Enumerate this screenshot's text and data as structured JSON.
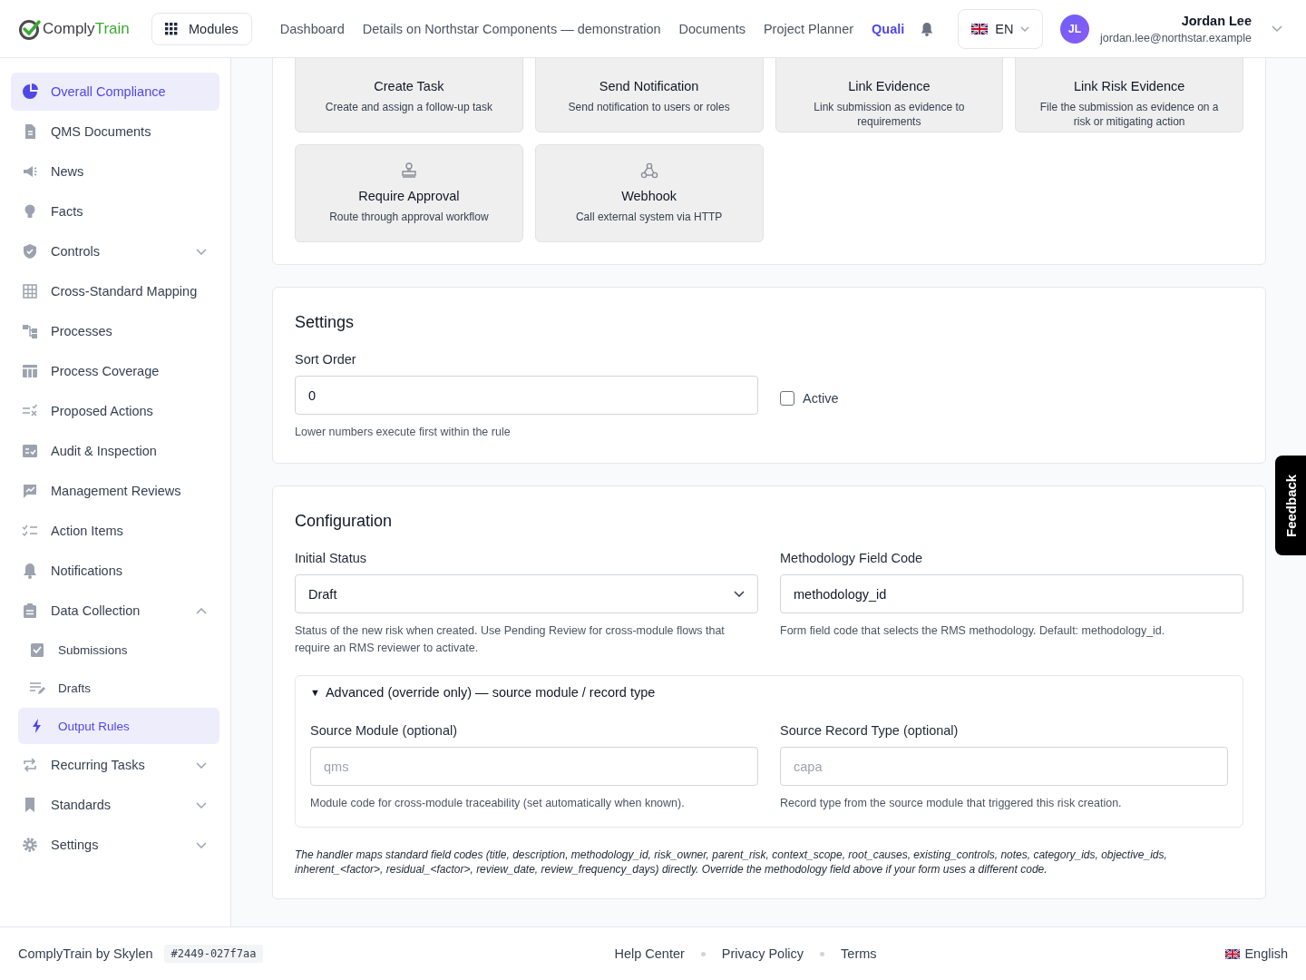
{
  "header": {
    "logo": {
      "first": "Comply",
      "second": "Train"
    },
    "modules_button": "Modules",
    "nav": [
      {
        "label": "Dashboard",
        "selected": false
      },
      {
        "label": "Details on Northstar Components — demonstration",
        "selected": false
      },
      {
        "label": "Documents",
        "selected": false
      },
      {
        "label": "Project Planner",
        "selected": false
      },
      {
        "label": "Quali",
        "selected": true
      }
    ],
    "language": "EN",
    "user": {
      "initials": "JL",
      "name": "Jordan Lee",
      "email": "jordan.lee@northstar.example"
    }
  },
  "sidebar": {
    "items": [
      {
        "label": "Overall Compliance",
        "selected": true
      },
      {
        "label": "QMS Documents",
        "selected": false
      },
      {
        "label": "News",
        "selected": false
      },
      {
        "label": "Facts",
        "selected": false
      },
      {
        "label": "Controls",
        "selected": false,
        "expanded": false
      },
      {
        "label": "Cross-Standard Mapping",
        "selected": false
      },
      {
        "label": "Processes",
        "selected": false
      },
      {
        "label": "Process Coverage",
        "selected": false
      },
      {
        "label": "Proposed Actions",
        "selected": false
      },
      {
        "label": "Audit & Inspection",
        "selected": false
      },
      {
        "label": "Management Reviews",
        "selected": false
      },
      {
        "label": "Action Items",
        "selected": false
      },
      {
        "label": "Notifications",
        "selected": false
      },
      {
        "label": "Data Collection",
        "selected": false,
        "expanded": true,
        "children": [
          {
            "label": "Submissions",
            "selected": false
          },
          {
            "label": "Drafts",
            "selected": false
          },
          {
            "label": "Output Rules",
            "selected": true
          }
        ]
      },
      {
        "label": "Recurring Tasks",
        "selected": false,
        "expanded": false
      },
      {
        "label": "Standards",
        "selected": false,
        "expanded": false
      },
      {
        "label": "Settings",
        "selected": false,
        "expanded": false
      }
    ]
  },
  "action_types": [
    {
      "title": "Create Task",
      "description": "Create and assign a follow-up task"
    },
    {
      "title": "Send Notification",
      "description": "Send notification to users or roles"
    },
    {
      "title": "Link Evidence",
      "description": "Link submission as evidence to requirements"
    },
    {
      "title": "Link Risk Evidence",
      "description": "File the submission as evidence on a risk or mitigating action"
    },
    {
      "title": "Require Approval",
      "description": "Route through approval workflow"
    },
    {
      "title": "Webhook",
      "description": "Call external system via HTTP"
    }
  ],
  "settings": {
    "title": "Settings",
    "sort_order": {
      "label": "Sort Order",
      "value": "0",
      "hint": "Lower numbers execute first within the rule"
    },
    "active": {
      "label": "Active",
      "checked": false
    }
  },
  "configuration": {
    "title": "Configuration",
    "initial_status": {
      "label": "Initial Status",
      "value": "Draft",
      "hint": "Status of the new risk when created. Use Pending Review for cross-module flows that require an RMS reviewer to activate."
    },
    "methodology_field_code": {
      "label": "Methodology Field Code",
      "value": "methodology_id",
      "hint": "Form field code that selects the RMS methodology. Default: methodology_id."
    },
    "advanced": {
      "toggle": "▼",
      "title": "Advanced (override only) — source module / record type",
      "expanded": true,
      "source_module": {
        "label": "Source Module (optional)",
        "placeholder": "qms",
        "hint": "Module code for cross-module traceability (set automatically when known)."
      },
      "source_record_type": {
        "label": "Source Record Type (optional)",
        "placeholder": "capa",
        "hint": "Record type from the source module that triggered this risk creation."
      }
    },
    "note": "The handler maps standard field codes (title, description, methodology_id, risk_owner, parent_risk, context_scope, root_causes, existing_controls, notes, category_ids, objective_ids, inherent_<factor>, residual_<factor>, review_date, review_frequency_days) directly. Override the methodology field above if your form uses a different code."
  },
  "feedback_tab": "Feedback",
  "footer": {
    "brand": "ComplyTrain by Skylen",
    "build": "#2449-027f7aa",
    "links": [
      "Help Center",
      "Privacy Policy",
      "Terms"
    ],
    "language": "English"
  }
}
